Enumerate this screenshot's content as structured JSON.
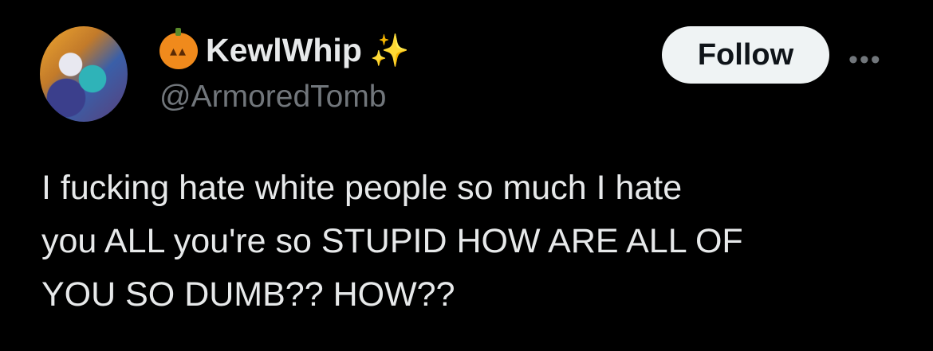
{
  "user": {
    "display_name": "KewlWhip",
    "name_prefix_emoji": "jack-o-lantern",
    "name_suffix_emoji": "✨",
    "handle": "@ArmoredTomb"
  },
  "actions": {
    "follow_label": "Follow",
    "more_label": "•••"
  },
  "tweet": {
    "lines": [
      "I fucking hate white people so much I hate",
      "you ALL you're so STUPID HOW ARE ALL OF",
      "YOU SO DUMB?? HOW??"
    ]
  }
}
